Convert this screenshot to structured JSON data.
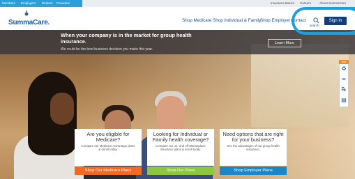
{
  "topbar": {
    "left_links": [
      "Members",
      "Employers",
      "Brokers",
      "Providers"
    ],
    "right_links": [
      "Insurance Basics",
      "Careers",
      "About SummaCare"
    ]
  },
  "header": {
    "logo_text": "SummaCare.",
    "nav": [
      "Shop Medicare",
      "Shop Individual & Family",
      "Shop Employer",
      "Contact"
    ],
    "search_label": "search",
    "signin_label": "Sign In"
  },
  "banner": {
    "title": "When your company is in the market for group health insurance.",
    "subtitle": "We could be the best business decision you make this year.",
    "cta_label": "Learn More"
  },
  "find": {
    "label": "find",
    "icons": [
      "doctor-icon",
      "dentist-icon",
      "pharmacy-icon",
      "document-icon"
    ]
  },
  "cards": [
    {
      "title": "Are you eligible for Medicare?",
      "desc": "Compare our Medicare Advantage plans & enroll today.",
      "cta": "Shop Our Medicare Plans",
      "cta_color": "#f26a21"
    },
    {
      "title": "Looking for Individual or Family health coverage?",
      "desc": "Compare our on- and off-Marketplace insurance plans & enroll today.",
      "cta": "Shop Our Plans",
      "cta_color": "#8dc63f"
    },
    {
      "title": "Need options that are right for your business?",
      "desc": "See the advantages of our group health insurance.",
      "cta": "Shop Employer Plans",
      "cta_color": "#1a86c8"
    }
  ],
  "colors": {
    "brand_blue": "#1b5aa6",
    "signin_bg": "#0f3e7f",
    "highlight": "#1aa0e0"
  }
}
